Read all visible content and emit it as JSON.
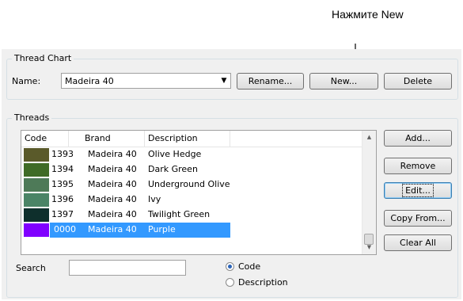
{
  "callout": "Нажмите New",
  "thread_chart": {
    "label": "Thread Chart",
    "name_label": "Name:",
    "name_value": "Madeira 40",
    "buttons": {
      "rename": "Rename...",
      "new": "New...",
      "delete": "Delete"
    }
  },
  "threads": {
    "label": "Threads",
    "columns": {
      "code": "Code",
      "brand": "Brand",
      "description": "Description"
    },
    "rows": [
      {
        "color": "#5a5a2a",
        "code": "1393",
        "brand": "Madeira 40",
        "description": "Olive Hedge"
      },
      {
        "color": "#3f6b26",
        "code": "1394",
        "brand": "Madeira 40",
        "description": "Dark Green"
      },
      {
        "color": "#4e7a58",
        "code": "1395",
        "brand": "Madeira 40",
        "description": "Underground Olive"
      },
      {
        "color": "#4a8466",
        "code": "1396",
        "brand": "Madeira 40",
        "description": "Ivy"
      },
      {
        "color": "#0e2f2c",
        "code": "1397",
        "brand": "Madeira 40",
        "description": "Twilight Green"
      },
      {
        "color": "#8000ff",
        "code": "0000",
        "brand": "Madeira 40",
        "description": "Purple"
      }
    ],
    "buttons": {
      "add": "Add...",
      "remove": "Remove",
      "edit": "Edit...",
      "copy_from": "Copy From...",
      "clear_all": "Clear All"
    },
    "search_label": "Search",
    "search_value": "",
    "radio_code": "Code",
    "radio_description": "Description"
  },
  "colors": {
    "selection": "#3399ff",
    "dialog_bg": "#f0f0f0"
  }
}
